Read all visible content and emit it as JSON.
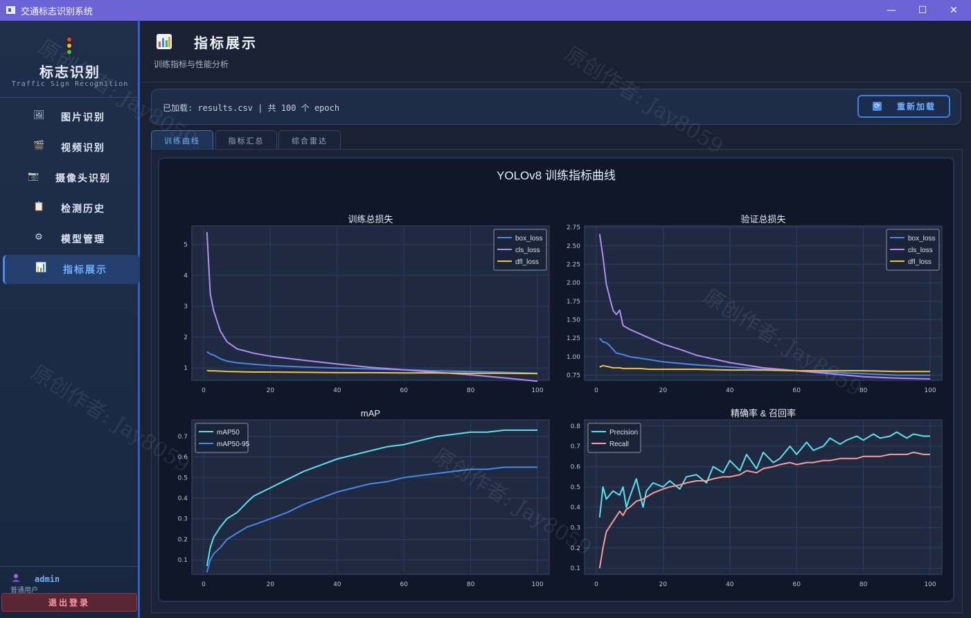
{
  "window": {
    "title": "交通标志识别系统",
    "minimize": "—",
    "maximize": "☐",
    "close": "✕"
  },
  "sidebar": {
    "brand_title": "标志识别",
    "brand_subtitle": "Traffic Sign Recognition",
    "items": [
      {
        "label": "图片识别",
        "icon": "image-icon",
        "glyph": "🖼"
      },
      {
        "label": "视频识别",
        "icon": "clapper-icon",
        "glyph": "🎬"
      },
      {
        "label": "摄像头识别",
        "icon": "camera-icon",
        "glyph": "📷"
      },
      {
        "label": "检测历史",
        "icon": "clipboard-icon",
        "glyph": "📋"
      },
      {
        "label": "模型管理",
        "icon": "gear-icon",
        "glyph": "⚙"
      },
      {
        "label": "指标展示",
        "icon": "chart-icon",
        "glyph": "📊",
        "active": true
      }
    ],
    "user": {
      "name": "admin",
      "role": "普通用户"
    },
    "logout_label": "退出登录"
  },
  "header": {
    "title": "指标展示",
    "subtitle": "训练指标与性能分析"
  },
  "info": {
    "text": "已加载: results.csv  |  共 100 个 epoch",
    "reload_label": "重新加载"
  },
  "tabs": [
    {
      "label": "训练曲线",
      "active": true
    },
    {
      "label": "指标汇总"
    },
    {
      "label": "综合雷达"
    }
  ],
  "watermark": "原创作者: Jay8059",
  "colors": {
    "box": "#4a86f0",
    "cls": "#b58cf5",
    "dfl": "#f7c23c",
    "map50": "#5ce1ef",
    "map5095": "#4a86f0",
    "precision": "#5ce1ef",
    "recall": "#ff9a9a",
    "accent": "#6fb0ff"
  },
  "chart_data": {
    "title": "YOLOv8 训练指标曲线",
    "subplots": [
      {
        "type": "line",
        "title": "训练总损失",
        "xlim": [
          0,
          100
        ],
        "ylim": [
          0.6,
          5.6
        ],
        "xticks": [
          0,
          20,
          40,
          60,
          80,
          100
        ],
        "yticks": [
          1,
          2,
          3,
          4,
          5
        ],
        "ytick_labels": [
          "1",
          "2",
          "3",
          "4",
          "5"
        ],
        "legend": "top-right",
        "grid": true,
        "x": [
          1,
          2,
          3,
          5,
          7,
          10,
          15,
          20,
          30,
          40,
          50,
          60,
          70,
          80,
          90,
          100
        ],
        "series": [
          {
            "name": "box_loss",
            "color": "#4a86f0",
            "values": [
              1.53,
              1.45,
              1.42,
              1.3,
              1.22,
              1.17,
              1.12,
              1.08,
              1.03,
              1.0,
              0.97,
              0.94,
              0.91,
              0.89,
              0.86,
              0.83
            ]
          },
          {
            "name": "cls_loss",
            "color": "#b58cf5",
            "values": [
              5.4,
              3.4,
              2.85,
              2.2,
              1.85,
              1.62,
              1.48,
              1.38,
              1.25,
              1.13,
              1.02,
              0.94,
              0.86,
              0.78,
              0.68,
              0.57
            ]
          },
          {
            "name": "dfl_loss",
            "color": "#f7c23c",
            "values": [
              0.92,
              0.91,
              0.91,
              0.9,
              0.89,
              0.88,
              0.87,
              0.87,
              0.86,
              0.85,
              0.85,
              0.84,
              0.84,
              0.83,
              0.83,
              0.82
            ]
          }
        ]
      },
      {
        "type": "line",
        "title": "验证总损失",
        "xlim": [
          0,
          100
        ],
        "ylim": [
          0.68,
          2.77
        ],
        "xticks": [
          0,
          20,
          40,
          60,
          80,
          100
        ],
        "yticks": [
          0.75,
          1.0,
          1.25,
          1.5,
          1.75,
          2.0,
          2.25,
          2.5,
          2.75
        ],
        "ytick_labels": [
          "0.75",
          "1.00",
          "1.25",
          "1.50",
          "1.75",
          "2.00",
          "2.25",
          "2.50",
          "2.75"
        ],
        "legend": "top-right",
        "grid": true,
        "x": [
          1,
          2,
          3,
          4,
          5,
          6,
          7,
          8,
          10,
          13,
          16,
          20,
          25,
          30,
          40,
          50,
          60,
          70,
          80,
          90,
          100
        ],
        "series": [
          {
            "name": "box_loss",
            "color": "#4a86f0",
            "values": [
              1.25,
              1.2,
              1.19,
              1.15,
              1.1,
              1.05,
              1.04,
              1.03,
              1.0,
              0.98,
              0.96,
              0.93,
              0.91,
              0.89,
              0.86,
              0.83,
              0.81,
              0.79,
              0.77,
              0.75,
              0.75
            ]
          },
          {
            "name": "cls_loss",
            "color": "#b58cf5",
            "values": [
              2.66,
              2.35,
              1.98,
              1.8,
              1.63,
              1.57,
              1.63,
              1.42,
              1.37,
              1.31,
              1.25,
              1.17,
              1.1,
              1.02,
              0.92,
              0.85,
              0.81,
              0.77,
              0.73,
              0.71,
              0.7
            ]
          },
          {
            "name": "dfl_loss",
            "color": "#f7c23c",
            "values": [
              0.86,
              0.88,
              0.87,
              0.86,
              0.85,
              0.85,
              0.85,
              0.84,
              0.84,
              0.84,
              0.83,
              0.83,
              0.83,
              0.83,
              0.82,
              0.82,
              0.81,
              0.81,
              0.81,
              0.8,
              0.8
            ]
          }
        ]
      },
      {
        "type": "line",
        "title": "mAP",
        "xlim": [
          0,
          100
        ],
        "ylim": [
          0.03,
          0.78
        ],
        "xticks": [
          0,
          20,
          40,
          60,
          80,
          100
        ],
        "yticks": [
          0.1,
          0.2,
          0.3,
          0.4,
          0.5,
          0.6,
          0.7
        ],
        "ytick_labels": [
          "0.1",
          "0.2",
          "0.3",
          "0.4",
          "0.5",
          "0.6",
          "0.7"
        ],
        "legend": "top-left",
        "grid": true,
        "x": [
          1,
          2,
          3,
          5,
          7,
          10,
          13,
          15,
          20,
          25,
          30,
          35,
          40,
          45,
          50,
          55,
          60,
          65,
          70,
          75,
          80,
          85,
          90,
          95,
          100
        ],
        "series": [
          {
            "name": "mAP50",
            "color": "#5ce1ef",
            "values": [
              0.07,
              0.16,
              0.21,
              0.26,
              0.3,
              0.33,
              0.38,
              0.41,
              0.45,
              0.49,
              0.53,
              0.56,
              0.59,
              0.61,
              0.63,
              0.65,
              0.66,
              0.68,
              0.7,
              0.71,
              0.72,
              0.72,
              0.73,
              0.73,
              0.73
            ]
          },
          {
            "name": "mAP50-95",
            "color": "#4a86f0",
            "values": [
              0.04,
              0.1,
              0.13,
              0.16,
              0.2,
              0.23,
              0.26,
              0.27,
              0.3,
              0.33,
              0.37,
              0.4,
              0.43,
              0.45,
              0.47,
              0.48,
              0.5,
              0.51,
              0.52,
              0.53,
              0.54,
              0.54,
              0.55,
              0.55,
              0.55
            ]
          }
        ]
      },
      {
        "type": "line",
        "title": "精确率 & 召回率",
        "xlim": [
          0,
          100
        ],
        "ylim": [
          0.07,
          0.83
        ],
        "xticks": [
          0,
          20,
          40,
          60,
          80,
          100
        ],
        "yticks": [
          0.1,
          0.2,
          0.3,
          0.4,
          0.5,
          0.6,
          0.7,
          0.8
        ],
        "ytick_labels": [
          "0.1",
          "0.2",
          "0.3",
          "0.4",
          "0.5",
          "0.6",
          "0.7",
          "0.8"
        ],
        "legend": "top-left",
        "grid": true,
        "x": [
          1,
          2,
          3,
          5,
          7,
          8,
          9,
          10,
          12,
          14,
          15,
          17,
          20,
          22,
          25,
          27,
          30,
          33,
          35,
          38,
          40,
          43,
          45,
          48,
          50,
          53,
          55,
          58,
          60,
          63,
          65,
          68,
          70,
          73,
          75,
          78,
          80,
          83,
          85,
          88,
          90,
          93,
          95,
          98,
          100
        ],
        "series": [
          {
            "name": "Precision",
            "color": "#5ce1ef",
            "values": [
              0.35,
              0.5,
              0.44,
              0.48,
              0.46,
              0.5,
              0.4,
              0.45,
              0.54,
              0.4,
              0.48,
              0.52,
              0.5,
              0.53,
              0.49,
              0.55,
              0.56,
              0.52,
              0.6,
              0.57,
              0.63,
              0.58,
              0.66,
              0.59,
              0.67,
              0.62,
              0.64,
              0.7,
              0.66,
              0.72,
              0.68,
              0.7,
              0.74,
              0.71,
              0.73,
              0.75,
              0.73,
              0.76,
              0.74,
              0.75,
              0.77,
              0.74,
              0.76,
              0.75,
              0.75
            ]
          },
          {
            "name": "Recall",
            "color": "#ff9a9a",
            "values": [
              0.1,
              0.2,
              0.28,
              0.33,
              0.38,
              0.36,
              0.39,
              0.4,
              0.43,
              0.44,
              0.45,
              0.47,
              0.49,
              0.5,
              0.51,
              0.52,
              0.53,
              0.53,
              0.54,
              0.55,
              0.55,
              0.56,
              0.58,
              0.57,
              0.59,
              0.6,
              0.61,
              0.62,
              0.61,
              0.62,
              0.62,
              0.63,
              0.63,
              0.64,
              0.64,
              0.64,
              0.65,
              0.65,
              0.65,
              0.66,
              0.66,
              0.66,
              0.67,
              0.66,
              0.66
            ]
          }
        ]
      }
    ]
  }
}
